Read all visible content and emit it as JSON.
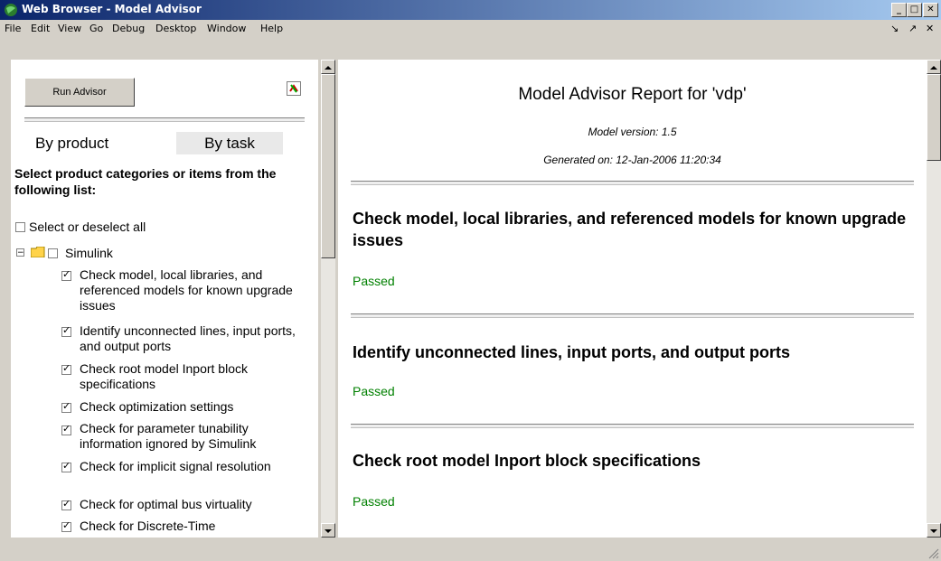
{
  "window": {
    "title": "Web Browser - Model Advisor"
  },
  "menu": [
    "File",
    "Edit",
    "View",
    "Go",
    "Debug",
    "Desktop",
    "Window",
    "Help"
  ],
  "left": {
    "run_button": "Run Advisor",
    "tab_by_product": "By product",
    "tab_by_task": "By task",
    "instructions": "Select product categories or items from the following list:",
    "select_all": "Select or deselect all",
    "group": "Simulink",
    "items": [
      "Check model, local libraries, and referenced models for known upgrade issues",
      "Identify unconnected lines, input ports, and output ports",
      "Check root model Inport block specifications",
      "Check optimization settings",
      "Check for parameter tunability information ignored by Simulink",
      "Check for implicit signal resolution",
      "Check for optimal bus virtuality",
      "Check for Discrete-Time"
    ]
  },
  "report": {
    "title": "Model Advisor Report for 'vdp'",
    "model_version": "Model version: 1.5",
    "generated_on": "Generated on: 12-Jan-2006 11:20:34",
    "sections": [
      {
        "heading": "Check model, local libraries, and referenced models for known upgrade issues",
        "status": "Passed"
      },
      {
        "heading": "Identify unconnected lines, input ports, and output ports",
        "status": "Passed"
      },
      {
        "heading": "Check root model Inport block specifications",
        "status": "Passed"
      }
    ],
    "status_color": "#008000"
  }
}
